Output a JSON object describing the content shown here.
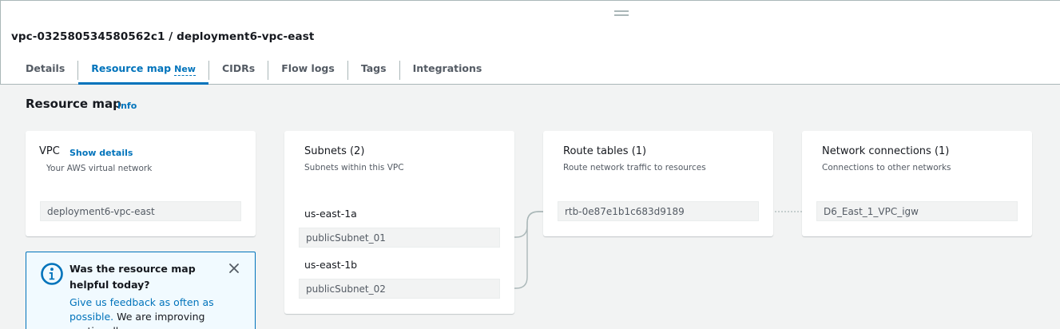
{
  "page": {
    "title": "vpc-032580534580562c1 / deployment6-vpc-east"
  },
  "tabs": [
    {
      "label": "Details"
    },
    {
      "label": "Resource map",
      "badge": "New"
    },
    {
      "label": "CIDRs"
    },
    {
      "label": "Flow logs"
    },
    {
      "label": "Tags"
    },
    {
      "label": "Integrations"
    }
  ],
  "active_tab": "Resource map",
  "resource_map": {
    "title": "Resource map",
    "info_label": "Info"
  },
  "vpc_card": {
    "title": "VPC",
    "show_details": "Show details",
    "subtitle": "Your AWS virtual network",
    "value": "deployment6-vpc-east"
  },
  "subnets_card": {
    "title": "Subnets (2)",
    "subtitle": "Subnets within this VPC",
    "groups": [
      {
        "az": "us-east-1a",
        "subnet": "publicSubnet_01"
      },
      {
        "az": "us-east-1b",
        "subnet": "publicSubnet_02"
      }
    ]
  },
  "route_tables_card": {
    "title": "Route tables (1)",
    "subtitle": "Route network traffic to resources",
    "value": "rtb-0e87e1b1c683d9189"
  },
  "network_connections_card": {
    "title": "Network connections (1)",
    "subtitle": "Connections to other networks",
    "value": "D6_East_1_VPC_igw"
  },
  "feedback": {
    "title": "Was the resource map helpful today?",
    "link_text": "Give us feedback as often as possible.",
    "body_text": " We are improving continually."
  },
  "colors": {
    "accent": "#0073bb",
    "background": "#f2f3f3",
    "card": "#ffffff",
    "text": "#16191f",
    "muted": "#545b64",
    "connector": "#aab7b8",
    "feedback_bg": "#f1faff"
  }
}
